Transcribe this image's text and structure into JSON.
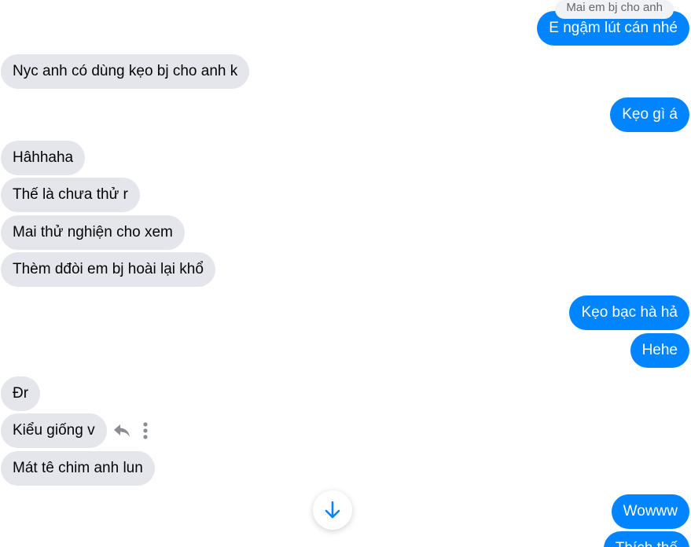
{
  "reply_preview": {
    "text": "Mai em bj cho anh"
  },
  "messages": [
    {
      "from": "me",
      "text": "E ngậm lút cán nhé"
    },
    {
      "from": "other",
      "text": "Nyc anh có dùng kẹo bj cho anh k"
    },
    {
      "from": "me",
      "text": "Kẹo gì á"
    },
    {
      "from": "other",
      "text": "Hâhhaha"
    },
    {
      "from": "other",
      "text": "Thế là chưa thử r"
    },
    {
      "from": "other",
      "text": "Mai thử nghiện cho xem"
    },
    {
      "from": "other",
      "text": "Thèm dđòi em bj hoài lại khổ"
    },
    {
      "from": "me",
      "text": "Kẹo bạc hà hả"
    },
    {
      "from": "me",
      "text": "Hehe"
    },
    {
      "from": "other",
      "text": "Đr"
    },
    {
      "from": "other",
      "text": "Kiểu giống v"
    },
    {
      "from": "other",
      "text": "Mát tê chim anh lun"
    },
    {
      "from": "me",
      "text": "Wowww"
    },
    {
      "from": "me",
      "text": "Thích thế"
    }
  ],
  "message_actions": {
    "icons": [
      "reply-icon",
      "more-options-icon"
    ]
  },
  "scroll_button": {
    "icon": "arrow-down-icon"
  },
  "colors": {
    "outgoing_bubble": "#0084ff",
    "incoming_bubble": "#e4e6eb",
    "accent": "#0084ff"
  }
}
